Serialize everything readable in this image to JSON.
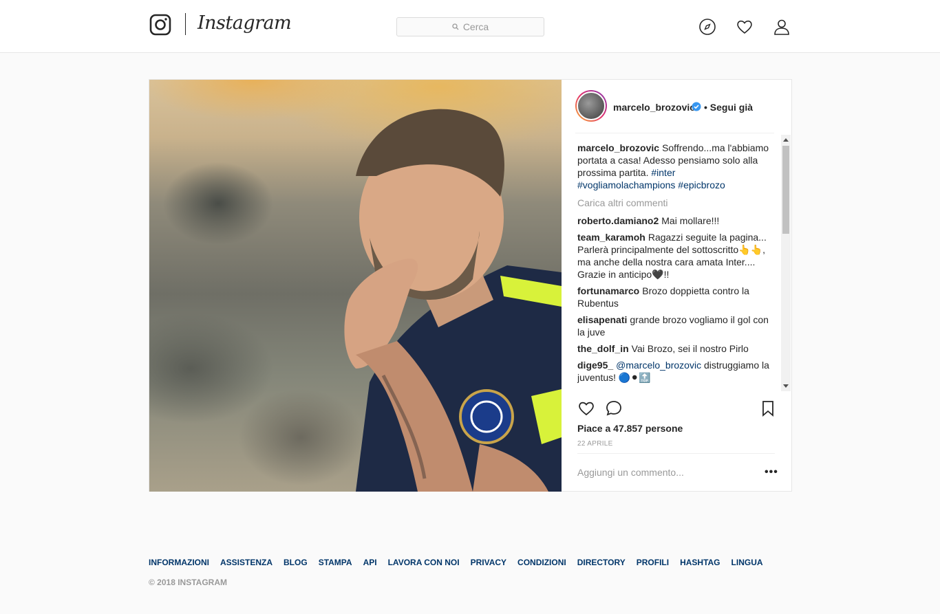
{
  "header": {
    "brand": "Instagram",
    "search": {
      "placeholder": "Cerca"
    },
    "icons": [
      "explore-icon",
      "heart-icon",
      "profile-icon"
    ]
  },
  "post": {
    "author": "marcelo_brozovic",
    "follow_state": "• Segui già",
    "caption": {
      "user": "marcelo_brozovic",
      "text": "Soffrendo...ma l'abbiamo portata a casa! Adesso pensiamo solo alla prossima partita. ",
      "hashtags": "#inter #vogliamolachampions #epicbrozo"
    },
    "load_more": "Carica altri commenti",
    "comments": [
      {
        "user": "roberto.damiano2",
        "text": "Mai mollare!!!"
      },
      {
        "user": "team_karamoh",
        "text": "Ragazzi seguite la pagina... Parlerà principalmente del sottoscritto👆👆, ma anche della nostra cara amata Inter.... Grazie in anticipo🖤!!"
      },
      {
        "user": "fortunamarco",
        "text": "Brozo doppietta contro la Rubentus"
      },
      {
        "user": "elisapenati",
        "text": "grande brozo vogliamo il gol con la juve"
      },
      {
        "user": "the_dolf_in",
        "text": "Vai Brozo, sei il nostro Pirlo"
      },
      {
        "user": "dige95_",
        "mention": "@marcelo_brozovic",
        "text": " distruggiamo la juventus! 🔵⚫🔝"
      }
    ],
    "likes": "Piace a 47.857 persone",
    "date": "22 APRILE",
    "add_comment_placeholder": "Aggiungi un commento..."
  },
  "footer": {
    "links": [
      "INFORMAZIONI",
      "ASSISTENZA",
      "BLOG",
      "STAMPA",
      "API",
      "LAVORA CON NOI",
      "PRIVACY",
      "CONDIZIONI",
      "DIRECTORY",
      "PROFILI",
      "HASHTAG",
      "LINGUA"
    ],
    "copyright": "© 2018 INSTAGRAM"
  },
  "colors": {
    "link": "#003569",
    "verified": "#3897f0",
    "muted": "#999999"
  }
}
